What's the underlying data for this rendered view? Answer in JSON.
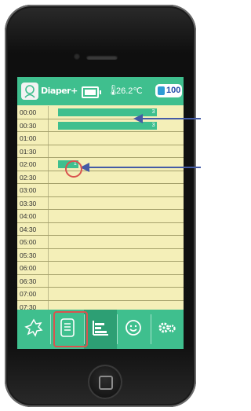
{
  "header": {
    "app_name": "Diaper+",
    "temperature": "26.2℃",
    "count": "100"
  },
  "times": [
    "00:00",
    "00:30",
    "01:00",
    "01:30",
    "02:00",
    "02:30",
    "03:00",
    "03:30",
    "04:00",
    "04:30",
    "05:00",
    "05:30",
    "06:00",
    "06:30",
    "07:00",
    "07:30"
  ],
  "events": [
    {
      "row": 0,
      "start": 0.07,
      "end": 0.8,
      "label": "3"
    },
    {
      "row": 1,
      "start": 0.07,
      "end": 0.8,
      "label": "3"
    },
    {
      "row": 4,
      "start": 0.07,
      "end": 0.22,
      "label": "1"
    }
  ],
  "nav": {
    "items": [
      "baby-leaf-icon",
      "note-list-icon",
      "bar-chart-icon",
      "smile-icon",
      "settings-gears-icon"
    ],
    "selected_index": 2
  },
  "colors": {
    "accent": "#3fbf8e",
    "grid_bg": "#f4efb8",
    "annotation_red": "#d9534f",
    "annotation_arrow": "#445ba6"
  }
}
